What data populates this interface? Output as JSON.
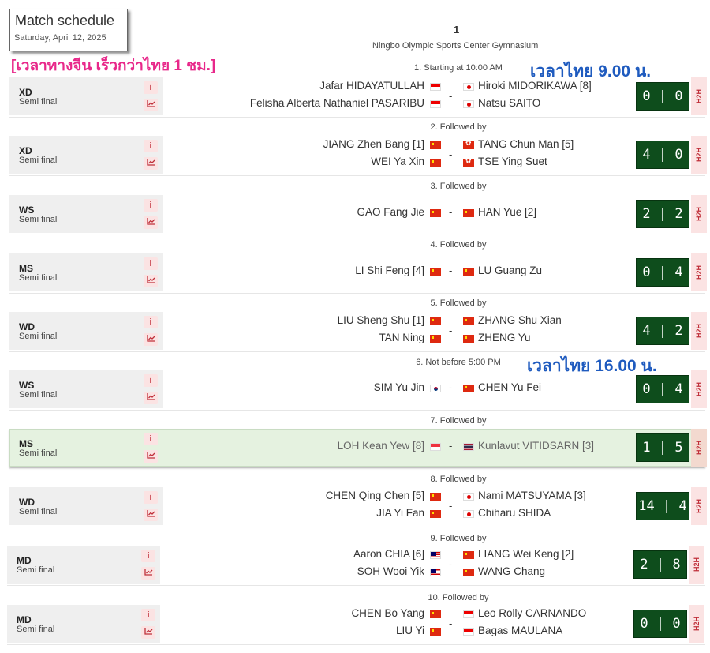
{
  "header": {
    "title": "Match schedule",
    "date": "Saturday, April 12, 2025"
  },
  "court": {
    "number": "1",
    "venue": "Ningbo Olympic Sports Center Gymnasium"
  },
  "notes": {
    "china_time": "[เวลาทางจีน เร็วกว่าไทย 1 ชม.]",
    "thai_time_1": "เวลาไทย 9.00 น.",
    "thai_time_2": "เวลาไทย 16.00 น."
  },
  "labels": {
    "dash": "-",
    "h2h": "H2H",
    "info_icon": "i"
  },
  "matches": [
    {
      "order": "1. Starting at 10:00 AM",
      "event": "XD",
      "round": "Semi final",
      "left": [
        {
          "name": "Jafar HIDAYATULLAH",
          "flag": "id"
        },
        {
          "name": "Felisha Alberta Nathaniel PASARIBU",
          "flag": "id"
        }
      ],
      "right": [
        {
          "name": "Hiroki MIDORIKAWA [8]",
          "flag": "jp"
        },
        {
          "name": "Natsu SAITO",
          "flag": "jp"
        }
      ],
      "score": "0 | 0"
    },
    {
      "order": "2. Followed by",
      "event": "XD",
      "round": "Semi final",
      "left": [
        {
          "name": "JIANG Zhen Bang [1]",
          "flag": "cn"
        },
        {
          "name": "WEI Ya Xin",
          "flag": "cn"
        }
      ],
      "right": [
        {
          "name": "TANG Chun Man [5]",
          "flag": "hk"
        },
        {
          "name": "TSE Ying Suet",
          "flag": "hk"
        }
      ],
      "score": "4 | 0"
    },
    {
      "order": "3. Followed by",
      "event": "WS",
      "round": "Semi final",
      "left": [
        {
          "name": "GAO Fang Jie",
          "flag": "cn"
        }
      ],
      "right": [
        {
          "name": "HAN Yue [2]",
          "flag": "cn"
        }
      ],
      "score": "2 | 2"
    },
    {
      "order": "4. Followed by",
      "event": "MS",
      "round": "Semi final",
      "left": [
        {
          "name": "LI Shi Feng [4]",
          "flag": "cn"
        }
      ],
      "right": [
        {
          "name": "LU Guang Zu",
          "flag": "cn"
        }
      ],
      "score": "0 | 4"
    },
    {
      "order": "5. Followed by",
      "event": "WD",
      "round": "Semi final",
      "left": [
        {
          "name": "LIU Sheng Shu [1]",
          "flag": "cn"
        },
        {
          "name": "TAN Ning",
          "flag": "cn"
        }
      ],
      "right": [
        {
          "name": "ZHANG Shu Xian",
          "flag": "cn"
        },
        {
          "name": "ZHENG Yu",
          "flag": "cn"
        }
      ],
      "score": "4 | 2"
    },
    {
      "order": "6. Not before 5:00 PM",
      "event": "WS",
      "round": "Semi final",
      "left": [
        {
          "name": "SIM Yu Jin",
          "flag": "kr"
        }
      ],
      "right": [
        {
          "name": "CHEN Yu Fei",
          "flag": "cn"
        }
      ],
      "score": "0 | 4"
    },
    {
      "order": "7. Followed by",
      "event": "MS",
      "round": "Semi final",
      "left": [
        {
          "name": "LOH Kean Yew [8]",
          "flag": "sg"
        }
      ],
      "right": [
        {
          "name": "Kunlavut VITIDSARN [3]",
          "flag": "th"
        }
      ],
      "score": "1 | 5"
    },
    {
      "order": "8. Followed by",
      "event": "WD",
      "round": "Semi final",
      "left": [
        {
          "name": "CHEN Qing Chen [5]",
          "flag": "cn"
        },
        {
          "name": "JIA Yi Fan",
          "flag": "cn"
        }
      ],
      "right": [
        {
          "name": "Nami MATSUYAMA [3]",
          "flag": "jp"
        },
        {
          "name": "Chiharu SHIDA",
          "flag": "jp"
        }
      ],
      "score": "14 | 4"
    },
    {
      "order": "9. Followed by",
      "event": "MD",
      "round": "Semi final",
      "left": [
        {
          "name": "Aaron CHIA [6]",
          "flag": "my"
        },
        {
          "name": "SOH Wooi Yik",
          "flag": "my"
        }
      ],
      "right": [
        {
          "name": "LIANG Wei Keng [2]",
          "flag": "cn"
        },
        {
          "name": "WANG Chang",
          "flag": "cn"
        }
      ],
      "score": "2 | 8"
    },
    {
      "order": "10. Followed by",
      "event": "MD",
      "round": "Semi final",
      "left": [
        {
          "name": "CHEN Bo Yang",
          "flag": "cn"
        },
        {
          "name": "LIU Yi",
          "flag": "cn"
        }
      ],
      "right": [
        {
          "name": "Leo Rolly CARNANDO",
          "flag": "id"
        },
        {
          "name": "Bagas MAULANA",
          "flag": "id"
        }
      ],
      "score": "0 | 0"
    }
  ]
}
